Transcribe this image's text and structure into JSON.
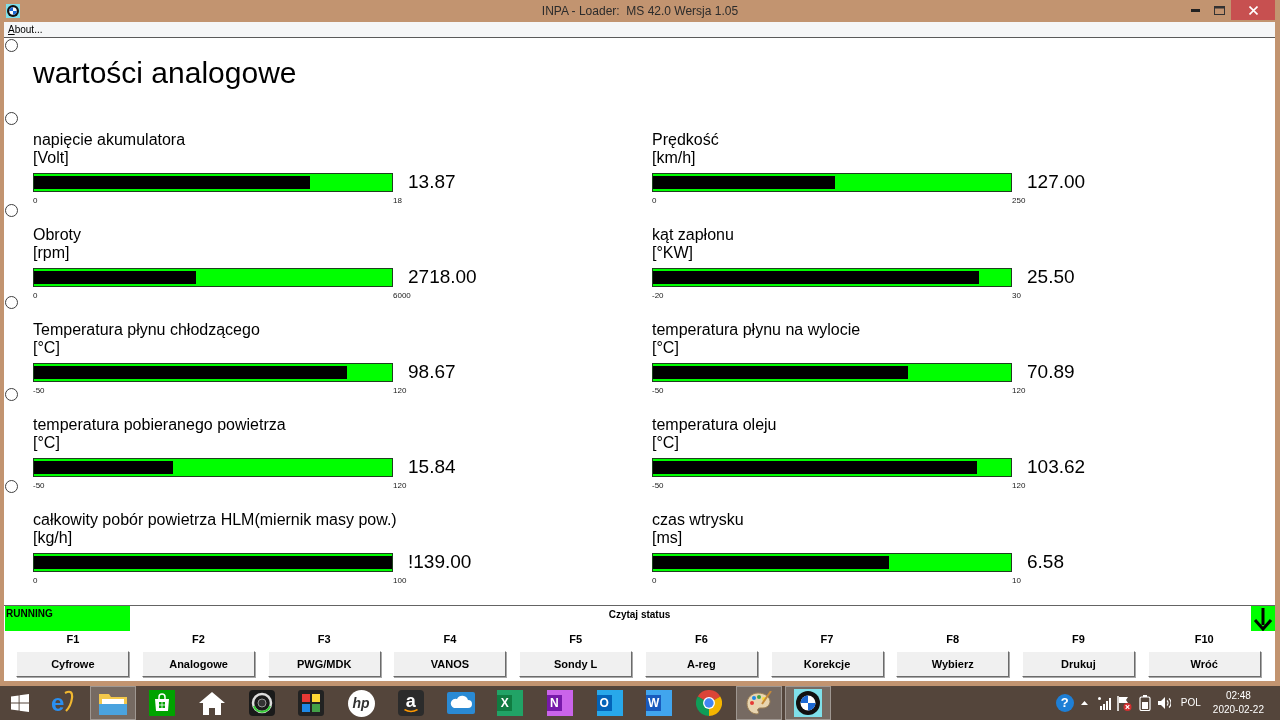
{
  "window": {
    "title": "INPA - Loader:  MS 42.0 Wersja 1.05"
  },
  "menu": [
    {
      "label": "About..."
    }
  ],
  "heading": "wartości analogowe",
  "radio_buttons": [
    {
      "selected": false
    },
    {
      "selected": false
    },
    {
      "selected": false
    },
    {
      "selected": false
    },
    {
      "selected": false
    },
    {
      "selected": false
    }
  ],
  "gauges": [
    {
      "label": "napięcie akumulatora",
      "unit": "[Volt]",
      "min": "0",
      "max": "18",
      "value": "13.87",
      "level": 0.77
    },
    {
      "label": "Prędkość",
      "unit": "[km/h]",
      "min": "0",
      "max": "250",
      "value": "127.00",
      "level": 0.508
    },
    {
      "label": "Obroty",
      "unit": "[rpm]",
      "min": "0",
      "max": "6000",
      "value": "2718.00",
      "level": 0.453
    },
    {
      "label": "kąt zapłonu",
      "unit": "[°KW]",
      "min": "-20",
      "max": "30",
      "value": "25.50",
      "level": 0.91
    },
    {
      "label": "Temperatura płynu chłodzącego",
      "unit": "[°C]",
      "min": "-50",
      "max": "120",
      "value": "98.67",
      "level": 0.875
    },
    {
      "label": "temperatura płynu na wylocie",
      "unit": "[°C]",
      "min": "-50",
      "max": "120",
      "value": "70.89",
      "level": 0.711
    },
    {
      "label": "temperatura pobieranego powietrza",
      "unit": "[°C]",
      "min": "-50",
      "max": "120",
      "value": "15.84",
      "level": 0.387
    },
    {
      "label": "temperatura oleju",
      "unit": "[°C]",
      "min": "-50",
      "max": "120",
      "value": "103.62",
      "level": 0.904
    },
    {
      "label": "całkowity pobór powietrza HLM(miernik masy pow.)",
      "unit": "[kg/h]",
      "min": "0",
      "max": "100",
      "value": "!139.00",
      "level": 1
    },
    {
      "label": "czas wtrysku",
      "unit": "[ms]",
      "min": "0",
      "max": "10",
      "value": "6.58",
      "level": 0.658
    }
  ],
  "status": {
    "state": "RUNNING",
    "message": "Czytaj status"
  },
  "function_keys": [
    {
      "key": "F1",
      "label": "Cyfrowe"
    },
    {
      "key": "F2",
      "label": "Analogowe"
    },
    {
      "key": "F3",
      "label": "PWG/MDK"
    },
    {
      "key": "F4",
      "label": "VANOS"
    },
    {
      "key": "F5",
      "label": "Sondy L"
    },
    {
      "key": "F6",
      "label": "A-reg"
    },
    {
      "key": "F7",
      "label": "Korekcje"
    },
    {
      "key": "F8",
      "label": "Wybierz"
    },
    {
      "key": "F9",
      "label": "Drukuj"
    },
    {
      "key": "F10",
      "label": "Wróć"
    }
  ],
  "taskbar": {
    "items": [
      {
        "kind": "start",
        "running": false
      },
      {
        "kind": "ebrowser",
        "glyph": "e",
        "running": false
      },
      {
        "kind": "folder",
        "running": true
      },
      {
        "kind": "store",
        "running": false
      },
      {
        "kind": "house",
        "running": false
      },
      {
        "kind": "lens",
        "running": false
      },
      {
        "kind": "puzzle",
        "running": false
      },
      {
        "kind": "circlemark",
        "glyph": "hp",
        "running": false
      },
      {
        "kind": "darktile",
        "glyph": "a",
        "running": false
      },
      {
        "kind": "cloud",
        "running": false
      },
      {
        "kind": "sheet",
        "glyph": "X",
        "running": false
      },
      {
        "kind": "notebook",
        "glyph": "N",
        "running": false
      },
      {
        "kind": "mail",
        "glyph": "O",
        "running": false
      },
      {
        "kind": "document",
        "glyph": "W",
        "running": false
      },
      {
        "kind": "wheel",
        "running": false
      },
      {
        "kind": "palette",
        "running": true
      },
      {
        "kind": "roundel",
        "running": true
      }
    ],
    "tray": {
      "help": "?",
      "language": "POL",
      "time": "02:48",
      "date": "2020-02-22"
    }
  }
}
